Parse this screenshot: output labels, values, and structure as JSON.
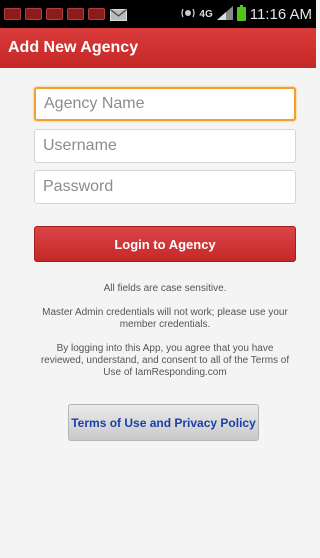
{
  "status_bar": {
    "notification_icons": [
      "app-notification-icon",
      "app-notification-icon",
      "app-notification-icon",
      "app-notification-icon",
      "app-notification-icon"
    ],
    "mail_icon": "mail-icon",
    "network": "4G",
    "time": "11:16 AM",
    "battery_color": "#52c41a"
  },
  "header": {
    "title": "Add New Agency",
    "background": "#c62828"
  },
  "form": {
    "agency_name_placeholder": "Agency Name",
    "username_placeholder": "Username",
    "password_placeholder": "Password",
    "login_label": "Login to Agency",
    "focus_color": "#f0a030"
  },
  "info": {
    "case_note": "All fields are case sensitive.",
    "admin_note": "Master Admin credentials will not work; please use your member credentials.",
    "consent_note": "By logging into this App, you agree that you have reviewed, understand, and consent to all of the Terms of Use of IamResponding.com"
  },
  "terms": {
    "label": "Terms of Use and Privacy Policy"
  }
}
